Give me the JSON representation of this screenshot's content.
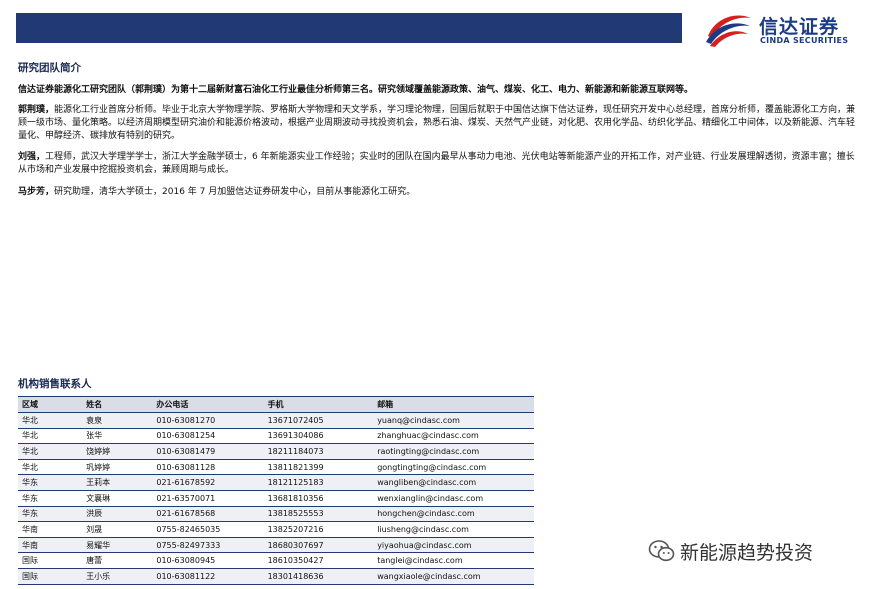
{
  "brand": {
    "name_cn": "信达证券",
    "name_en": "CINDA SECURITIES"
  },
  "team": {
    "title": "研究团队简介",
    "intro": "信达证券能源化工研究团队（郭荆璞）为第十二届新财富石油化工行业最佳分析师第三名。研究领域覆盖能源政策、油气、煤炭、化工、电力、新能源和新能源互联网等。",
    "members": [
      {
        "name": "郭荆璞，",
        "bio": "能源化工行业首席分析师。毕业于北京大学物理学院、罗格斯大学物理和天文学系，学习理论物理，回国后就职于中国信达旗下信达证券，现任研究开发中心总经理，首席分析师，覆盖能源化工方向，兼顾一级市场、量化策略。以经济周期模型研究油价和能源价格波动，根据产业周期波动寻找投资机会，熟悉石油、煤炭、天然气产业链，对化肥、农用化学品、纺织化学品、精细化工中间体，以及新能源、汽车轻量化、甲醇经济、碳排放有特别的研究。"
      },
      {
        "name": "刘强，",
        "bio": "工程师，武汉大学理学学士，浙江大学金融学硕士，6 年新能源实业工作经验；实业时的团队在国内最早从事动力电池、光伏电站等新能源产业的开拓工作，对产业链、行业发展理解透彻，资源丰富；擅长从市场和产业发展中挖掘投资机会，兼顾周期与成长。"
      },
      {
        "name": "马步芳，",
        "bio": "研究助理，清华大学硕士，2016 年 7 月加盟信达证券研发中心，目前从事能源化工研究。"
      }
    ]
  },
  "sales": {
    "title": "机构销售联系人",
    "headers": [
      "区域",
      "姓名",
      "办公电话",
      "手机",
      "邮箱"
    ],
    "rows": [
      [
        "华北",
        "袁泉",
        "010-63081270",
        "13671072405",
        "yuanq@cindasc.com"
      ],
      [
        "华北",
        "张华",
        "010-63081254",
        "13691304086",
        "zhanghuac@cindasc.com"
      ],
      [
        "华北",
        "饶婷婷",
        "010-63081479",
        "18211184073",
        "raotingting@cindasc.com"
      ],
      [
        "华北",
        "巩婷婷",
        "010-63081128",
        "13811821399",
        "gongtingting@cindasc.com"
      ],
      [
        "华东",
        "王莉本",
        "021-61678592",
        "18121125183",
        "wangliben@cindasc.com"
      ],
      [
        "华东",
        "文襄琳",
        "021-63570071",
        "13681810356",
        "wenxianglin@cindasc.com"
      ],
      [
        "华东",
        "洪辰",
        "021-61678568",
        "13818525553",
        "hongchen@cindasc.com"
      ],
      [
        "华南",
        "刘晟",
        "0755-82465035",
        "13825207216",
        "liusheng@cindasc.com"
      ],
      [
        "华南",
        "易耀华",
        "0755-82497333",
        "18680307697",
        "yiyaohua@cindasc.com"
      ],
      [
        "国际",
        "唐蕾",
        "010-63080945",
        "18610350427",
        "tanglei@cindasc.com"
      ],
      [
        "国际",
        "王小乐",
        "010-63081122",
        "18301418636",
        "wangxiaole@cindasc.com"
      ]
    ]
  },
  "watermark": {
    "text": "新能源趋势投资",
    "icon": "wechat-icon"
  },
  "colors": {
    "navy": "#213a75",
    "brand_red": "#d6201f",
    "header_fill": "#d9dde6"
  }
}
